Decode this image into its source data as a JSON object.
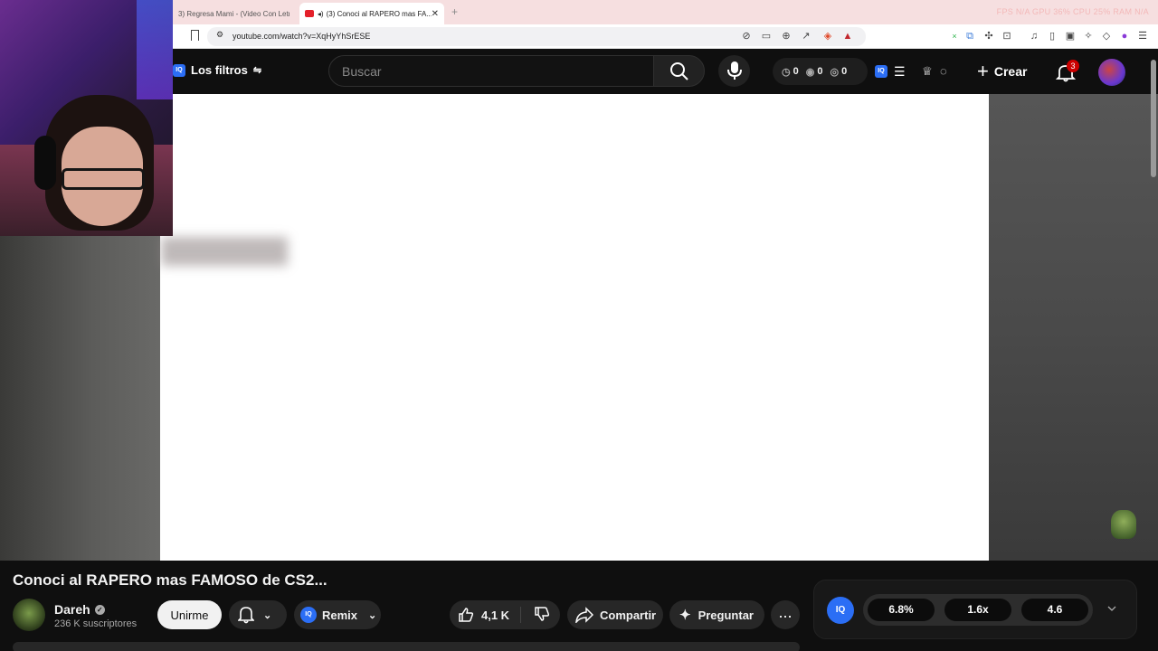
{
  "browser": {
    "tabs": [
      {
        "title": "3) Regresa Mami - (Video Con Letra"
      },
      {
        "title": "(3) Conoci al RAPERO mas FA..."
      }
    ],
    "stats": "FPS N/A   GPU 36%   CPU 25%   RAM N/A",
    "url": "youtube.com/watch?v=XqHyYhSrESE"
  },
  "youtube": {
    "filters_label": "Los filtros",
    "search_placeholder": "Buscar",
    "counters": [
      "0",
      "0",
      "0"
    ],
    "create_label": "Crear",
    "notifications_count": "3"
  },
  "video": {
    "title": "Conoci al RAPERO mas FAMOSO de CS2...",
    "channel": "Dareh",
    "subscribers": "236 K suscriptores",
    "join_label": "Unirme",
    "remix_label": "Remix",
    "likes": "4,1 K",
    "share_label": "Compartir",
    "ask_label": "Preguntar",
    "more_label": "..."
  },
  "iq_panel": {
    "badge": "IQ",
    "stats": [
      "6.8%",
      "1.6x",
      "4.6"
    ]
  },
  "colors": {
    "yt_bg": "#0f0f0f",
    "iq_blue": "#2b6ef5",
    "badge_red": "#cc0000",
    "tabbar_bg": "#f6dfe0"
  }
}
